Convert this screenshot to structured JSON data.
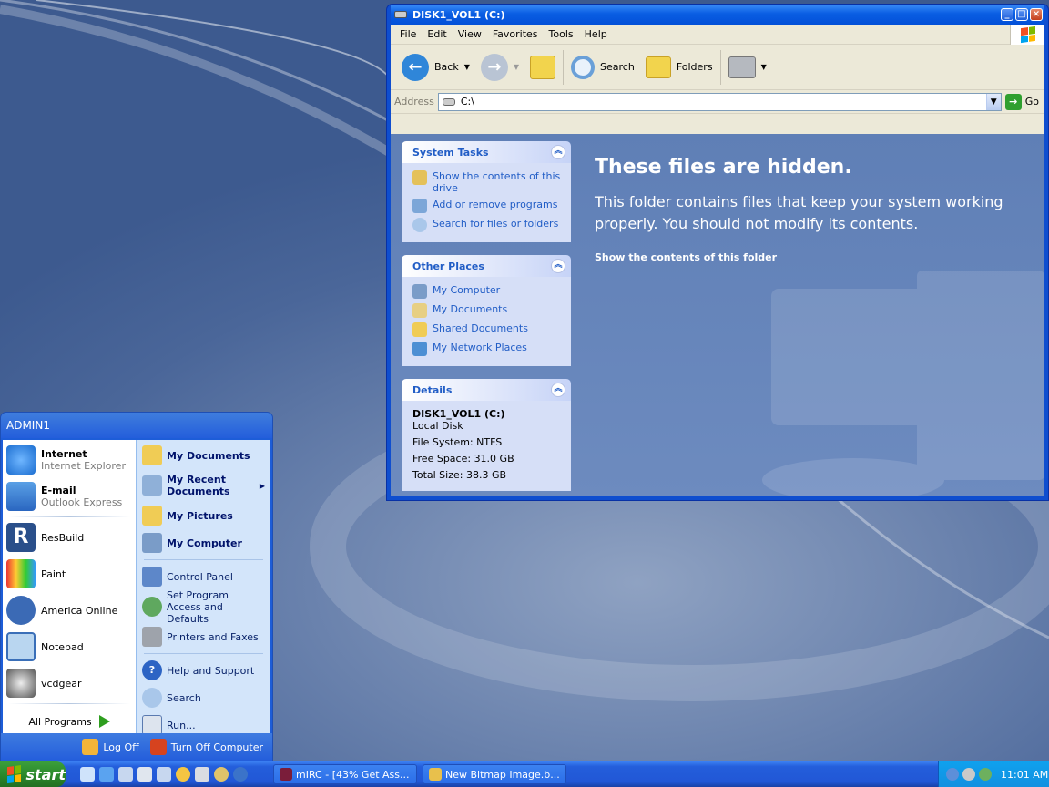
{
  "window": {
    "title": "DISK1_VOL1 (C:)",
    "menu": [
      "File",
      "Edit",
      "View",
      "Favorites",
      "Tools",
      "Help"
    ],
    "toolbar": {
      "back": "Back",
      "search": "Search",
      "folders": "Folders"
    },
    "address": {
      "label": "Address",
      "value": "C:\\",
      "go": "Go"
    },
    "system_tasks": {
      "title": "System Tasks",
      "items": [
        "Show the contents of this drive",
        "Add or remove programs",
        "Search for files or folders"
      ]
    },
    "other_places": {
      "title": "Other Places",
      "items": [
        "My Computer",
        "My Documents",
        "Shared Documents",
        "My Network Places"
      ]
    },
    "details": {
      "title": "Details",
      "name": "DISK1_VOL1 (C:)",
      "type": "Local Disk",
      "fs": "File System: NTFS",
      "free": "Free Space: 31.0 GB",
      "total": "Total Size: 38.3 GB"
    },
    "hidden": {
      "title": "These files are hidden.",
      "text": "This folder contains files that keep your system working properly. You should not modify its contents.",
      "link": "Show the contents of this folder"
    }
  },
  "start_menu": {
    "user": "ADMIN1",
    "pinned": [
      {
        "title": "Internet",
        "sub": "Internet Explorer"
      },
      {
        "title": "E-mail",
        "sub": "Outlook Express"
      }
    ],
    "recent": [
      "ResBuild",
      "Paint",
      "America Online",
      "Notepad",
      "vcdgear"
    ],
    "all_programs": "All Programs",
    "right": [
      "My Documents",
      "My Recent Documents",
      "My Pictures",
      "My Computer",
      "Control Panel",
      "Set Program Access and Defaults",
      "Printers and Faxes",
      "Help and Support",
      "Search",
      "Run..."
    ],
    "logoff": "Log Off",
    "turnoff": "Turn Off Computer"
  },
  "taskbar": {
    "start": "start",
    "tasks": [
      "mIRC - [43% Get Ass...",
      "New Bitmap Image.b..."
    ],
    "clock": "11:01 AM"
  },
  "colors": {
    "accent": "#245edb",
    "start_green": "#2b8a2b",
    "link": "#215dc6"
  }
}
